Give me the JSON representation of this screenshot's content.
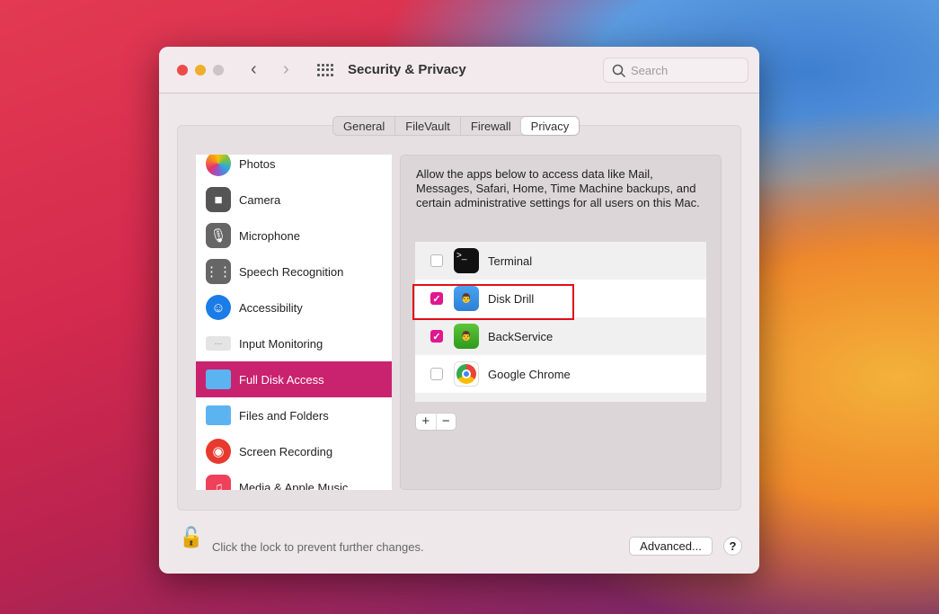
{
  "window": {
    "title": "Security & Privacy",
    "search_placeholder": "Search"
  },
  "tabs": [
    {
      "label": "General"
    },
    {
      "label": "FileVault"
    },
    {
      "label": "Firewall"
    },
    {
      "label": "Privacy",
      "active": true
    }
  ],
  "sidebar": {
    "items": [
      {
        "label": "Photos",
        "icon": "photos-icon"
      },
      {
        "label": "Camera",
        "icon": "camera-icon"
      },
      {
        "label": "Microphone",
        "icon": "microphone-icon"
      },
      {
        "label": "Speech Recognition",
        "icon": "waveform-icon"
      },
      {
        "label": "Accessibility",
        "icon": "accessibility-icon"
      },
      {
        "label": "Input Monitoring",
        "icon": "keyboard-icon"
      },
      {
        "label": "Full Disk Access",
        "icon": "folder-icon",
        "selected": true
      },
      {
        "label": "Files and Folders",
        "icon": "folder-icon"
      },
      {
        "label": "Screen Recording",
        "icon": "record-icon"
      },
      {
        "label": "Media & Apple Music",
        "icon": "music-icon"
      }
    ]
  },
  "main": {
    "description": "Allow the apps below to access data like Mail, Messages, Safari, Home, Time Machine backups, and certain administrative settings for all users on this Mac.",
    "apps": [
      {
        "name": "Terminal",
        "checked": false
      },
      {
        "name": "Disk Drill",
        "checked": true,
        "highlighted": true
      },
      {
        "name": "BackService",
        "checked": true
      },
      {
        "name": "Google Chrome",
        "checked": false
      }
    ],
    "add_label": "+",
    "remove_label": "−"
  },
  "footer": {
    "lock_text": "Click the lock to prevent further changes.",
    "advanced_label": "Advanced...",
    "help_label": "?"
  },
  "colors": {
    "accent": "#c9226e",
    "checkbox": "#e0178f",
    "highlight_box": "#e0101a"
  }
}
